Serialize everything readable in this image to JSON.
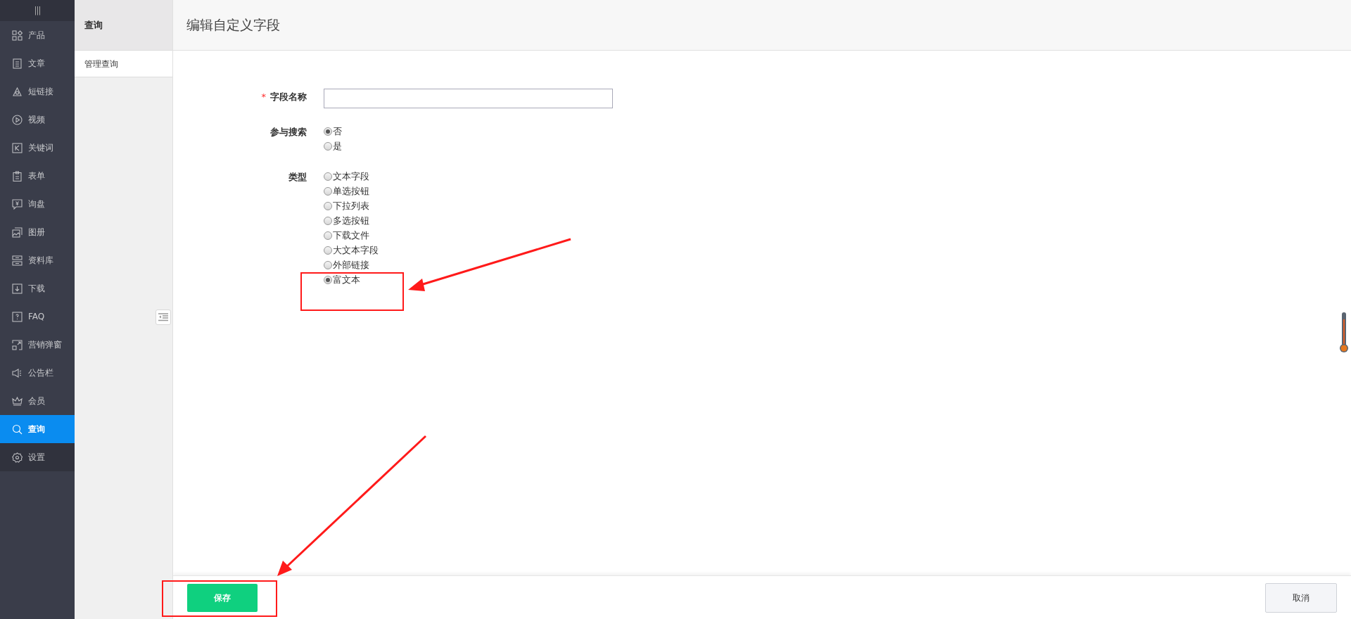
{
  "sidebar": {
    "toggle": "|||",
    "items": [
      {
        "label": "产品",
        "selected": false
      },
      {
        "label": "文章",
        "selected": false
      },
      {
        "label": "短链接",
        "selected": false
      },
      {
        "label": "视频",
        "selected": false
      },
      {
        "label": "关键词",
        "selected": false
      },
      {
        "label": "表单",
        "selected": false
      },
      {
        "label": "询盘",
        "selected": false
      },
      {
        "label": "图册",
        "selected": false
      },
      {
        "label": "资料库",
        "selected": false
      },
      {
        "label": "下载",
        "selected": false
      },
      {
        "label": "FAQ",
        "selected": false
      },
      {
        "label": "营销弹窗",
        "selected": false
      },
      {
        "label": "公告栏",
        "selected": false
      },
      {
        "label": "会员",
        "selected": false
      },
      {
        "label": "查询",
        "selected": true
      },
      {
        "label": "设置",
        "selected": false
      }
    ]
  },
  "subpanel": {
    "title": "查询",
    "items": [
      {
        "label": "管理查询",
        "selected": true
      }
    ]
  },
  "page": {
    "title": "编辑自定义字段"
  },
  "form": {
    "fields": [
      {
        "kind": "text",
        "label": "字段名称",
        "required_mark": "*"
      },
      {
        "kind": "radio",
        "label": "参与搜索",
        "options": [
          {
            "label": "否",
            "selected": true
          },
          {
            "label": "是",
            "selected": false
          }
        ]
      },
      {
        "kind": "radio",
        "label": "类型",
        "options": [
          {
            "label": "文本字段",
            "selected": false
          },
          {
            "label": "单选按钮",
            "selected": false
          },
          {
            "label": "下拉列表",
            "selected": false
          },
          {
            "label": "多选按钮",
            "selected": false
          },
          {
            "label": "下载文件",
            "selected": false
          },
          {
            "label": "大文本字段",
            "selected": false
          },
          {
            "label": "外部链接",
            "selected": false
          },
          {
            "label": "富文本",
            "selected": true
          }
        ]
      }
    ]
  },
  "buttons": [
    {
      "kind": "primary",
      "label": "保存"
    },
    {
      "kind": "secondary",
      "label": "取消"
    }
  ]
}
